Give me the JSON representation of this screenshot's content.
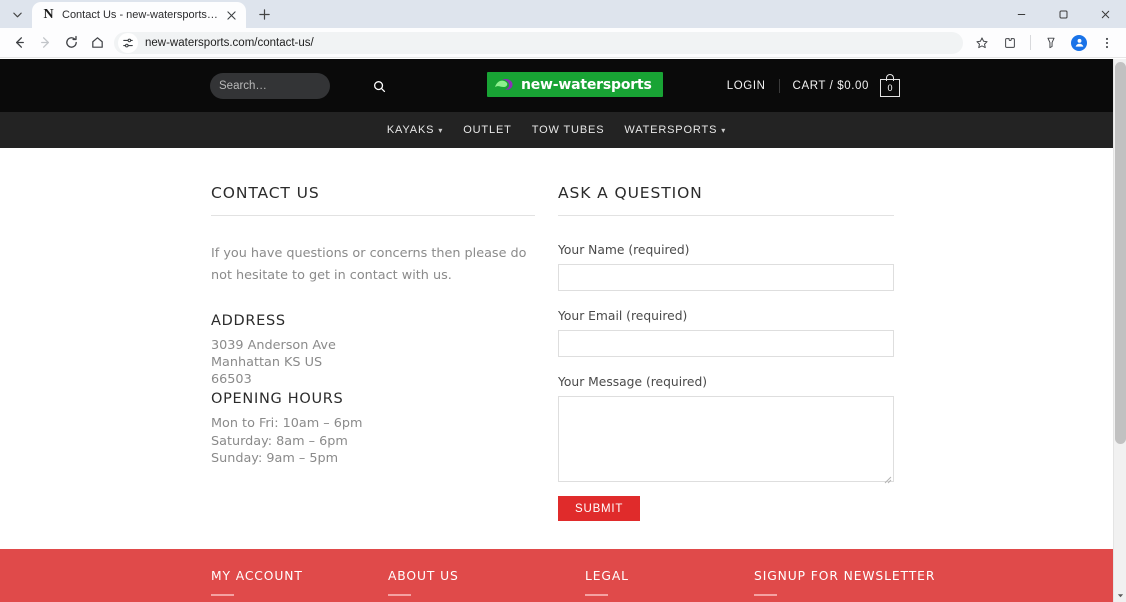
{
  "browser": {
    "tab": {
      "title": "Contact Us - new-watersports…",
      "favicon_letter": "N"
    },
    "new_tab_label": "+",
    "window": {
      "minimize": "–",
      "maximize": "□",
      "close": "×"
    },
    "toolbar": {
      "back": "back-arrow",
      "forward": "forward-arrow",
      "reload": "reload",
      "home": "home",
      "site_info": "site-settings",
      "url": "new-watersports.com/contact-us/",
      "bookmark": "star",
      "extensions": "puzzle",
      "split": "split-view",
      "profile": "avatar",
      "menu": "kebab-menu"
    }
  },
  "site": {
    "search": {
      "placeholder": "Search…",
      "value": ""
    },
    "logo": {
      "text": "new-watersports",
      "bg": "#18a334"
    },
    "account": {
      "login": "LOGIN",
      "cart": "CART / $0.00",
      "cart_count": "0"
    },
    "nav": [
      {
        "label": "KAYAKS",
        "has_caret": true
      },
      {
        "label": "OUTLET",
        "has_caret": false
      },
      {
        "label": "TOW TUBES",
        "has_caret": false
      },
      {
        "label": "WATERSPORTS",
        "has_caret": true
      }
    ]
  },
  "contact": {
    "heading": "CONTACT US",
    "intro": "If you have questions or concerns then please do not hesitate to get in contact with us.",
    "address_heading": "ADDRESS",
    "address_lines": [
      "3039 Anderson Ave",
      "Manhattan KS US",
      "66503"
    ],
    "hours_heading": "OPENING HOURS",
    "hours_lines": [
      "Mon to Fri: 10am – 6pm",
      "Saturday: 8am – 6pm",
      "Sunday: 9am – 5pm"
    ]
  },
  "form": {
    "heading": "ASK A QUESTION",
    "name_label": "Your Name (required)",
    "name_value": "",
    "email_label": "Your Email (required)",
    "email_value": "",
    "message_label": "Your Message (required)",
    "message_value": "",
    "submit_label": "SUBMIT",
    "submit_color": "#e02b2b"
  },
  "footer": {
    "bg": "#e04a4a",
    "columns": [
      {
        "title": "MY ACCOUNT"
      },
      {
        "title": "ABOUT US"
      },
      {
        "title": "LEGAL"
      },
      {
        "title": "SIGNUP FOR NEWSLETTER"
      }
    ]
  }
}
